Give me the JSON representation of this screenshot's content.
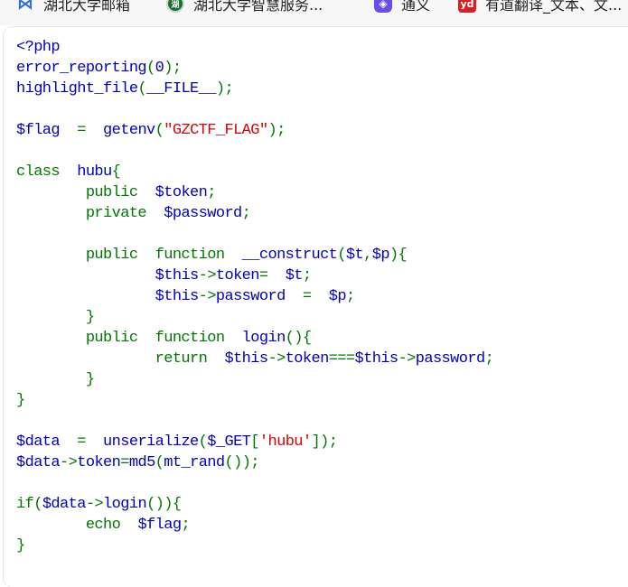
{
  "bookmarks": [
    {
      "label": "湖北大学邮箱",
      "icon": "mail-logo-icon",
      "glyph": "⋈"
    },
    {
      "label": "湖北大学智慧服务...",
      "icon": "university-seal-icon",
      "glyph": "湖"
    },
    {
      "label": "通义",
      "icon": "tongyi-logo-icon",
      "glyph": "◈"
    },
    {
      "label": "有道翻译_文本、文...",
      "icon": "youdao-logo-icon",
      "glyph": "yd"
    }
  ],
  "code_lines": [
    [
      [
        "def",
        "<?php"
      ]
    ],
    [
      [
        "def",
        "error_reporting"
      ],
      [
        "kw",
        "("
      ],
      [
        "def",
        "0"
      ],
      [
        "kw",
        ");"
      ]
    ],
    [
      [
        "def",
        "highlight_file"
      ],
      [
        "kw",
        "("
      ],
      [
        "def",
        "__FILE__"
      ],
      [
        "kw",
        ");"
      ]
    ],
    [],
    [
      [
        "def",
        "$flag"
      ],
      [
        "kw",
        "  =  "
      ],
      [
        "def",
        "getenv"
      ],
      [
        "kw",
        "("
      ],
      [
        "str",
        "\"GZCTF_FLAG\""
      ],
      [
        "kw",
        ");"
      ]
    ],
    [],
    [
      [
        "kw",
        "class  "
      ],
      [
        "def",
        "hubu"
      ],
      [
        "kw",
        "{"
      ]
    ],
    [
      [
        "kw",
        "        public  "
      ],
      [
        "def",
        "$token"
      ],
      [
        "kw",
        ";"
      ]
    ],
    [
      [
        "kw",
        "        private  "
      ],
      [
        "def",
        "$password"
      ],
      [
        "kw",
        ";"
      ]
    ],
    [],
    [
      [
        "kw",
        "        public  function  "
      ],
      [
        "def",
        "__construct"
      ],
      [
        "kw",
        "("
      ],
      [
        "def",
        "$t"
      ],
      [
        "kw",
        ","
      ],
      [
        "def",
        "$p"
      ],
      [
        "kw",
        "){"
      ]
    ],
    [
      [
        "kw",
        "                "
      ],
      [
        "def",
        "$this"
      ],
      [
        "kw",
        "->"
      ],
      [
        "def",
        "token"
      ],
      [
        "kw",
        "=  "
      ],
      [
        "def",
        "$t"
      ],
      [
        "kw",
        ";"
      ]
    ],
    [
      [
        "kw",
        "                "
      ],
      [
        "def",
        "$this"
      ],
      [
        "kw",
        "->"
      ],
      [
        "def",
        "password  "
      ],
      [
        "kw",
        "=  "
      ],
      [
        "def",
        "$p"
      ],
      [
        "kw",
        ";"
      ]
    ],
    [
      [
        "kw",
        "        }"
      ]
    ],
    [
      [
        "kw",
        "        public  function  "
      ],
      [
        "def",
        "login"
      ],
      [
        "kw",
        "(){"
      ]
    ],
    [
      [
        "kw",
        "                return  "
      ],
      [
        "def",
        "$this"
      ],
      [
        "kw",
        "->"
      ],
      [
        "def",
        "token"
      ],
      [
        "kw",
        "==="
      ],
      [
        "def",
        "$this"
      ],
      [
        "kw",
        "->"
      ],
      [
        "def",
        "password"
      ],
      [
        "kw",
        ";"
      ]
    ],
    [
      [
        "kw",
        "        }"
      ]
    ],
    [
      [
        "kw",
        "}"
      ]
    ],
    [],
    [
      [
        "def",
        "$data"
      ],
      [
        "kw",
        "  =  "
      ],
      [
        "def",
        "unserialize"
      ],
      [
        "kw",
        "("
      ],
      [
        "def",
        "$_GET"
      ],
      [
        "kw",
        "["
      ],
      [
        "str",
        "'hubu'"
      ],
      [
        "kw",
        "]);"
      ]
    ],
    [
      [
        "def",
        "$data"
      ],
      [
        "kw",
        "->"
      ],
      [
        "def",
        "token"
      ],
      [
        "kw",
        "="
      ],
      [
        "def",
        "md5"
      ],
      [
        "kw",
        "("
      ],
      [
        "def",
        "mt_rand"
      ],
      [
        "kw",
        "());"
      ]
    ],
    [],
    [
      [
        "kw",
        "if("
      ],
      [
        "def",
        "$data"
      ],
      [
        "kw",
        "->"
      ],
      [
        "def",
        "login"
      ],
      [
        "kw",
        "()){"
      ]
    ],
    [
      [
        "kw",
        "        echo  "
      ],
      [
        "def",
        "$flag"
      ],
      [
        "kw",
        ";"
      ]
    ],
    [
      [
        "kw",
        "}"
      ]
    ]
  ]
}
